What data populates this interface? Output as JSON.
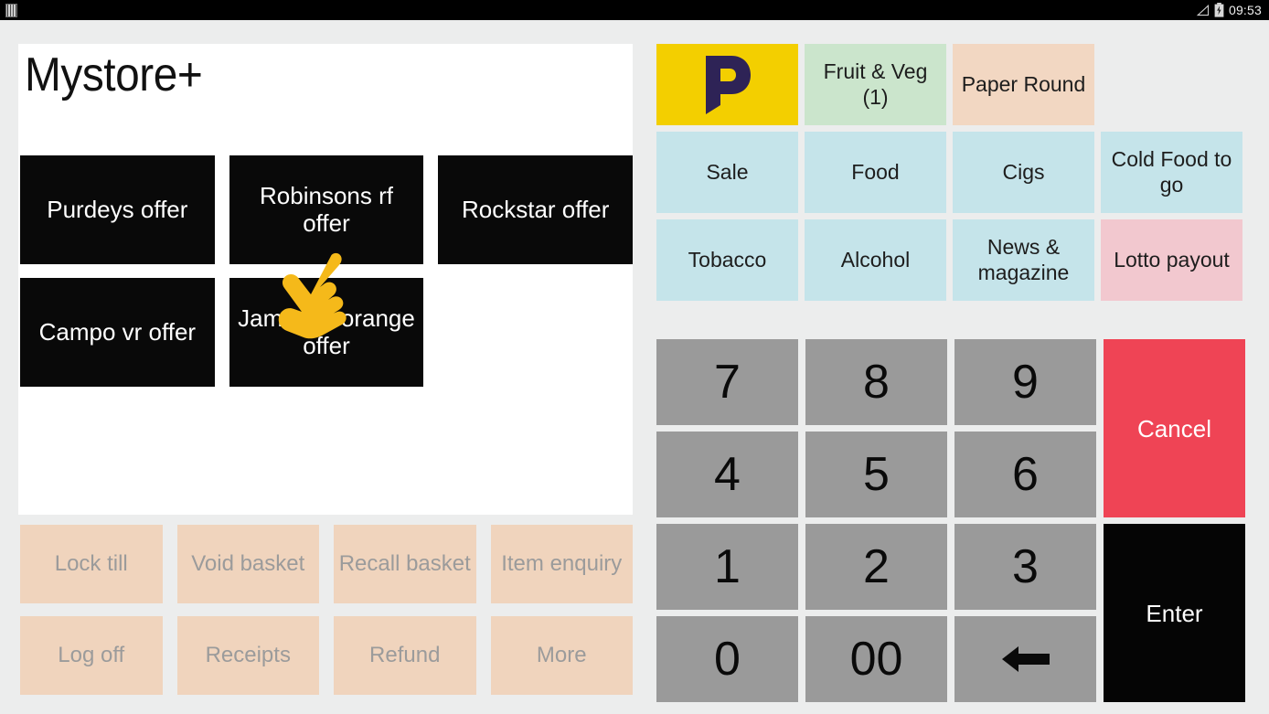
{
  "status_bar": {
    "left_icon": "barcode-icon",
    "signal_icon": "signal-triangle-icon",
    "battery_icon": "battery-charging-icon",
    "clock": "09:53"
  },
  "store": {
    "logo_text": "Mystore+"
  },
  "offers": [
    [
      {
        "label": "Purdeys offer"
      },
      {
        "label": "Robinsons rf offer"
      },
      {
        "label": "Rockstar offer"
      }
    ],
    [
      {
        "label": "Campo vr offer"
      },
      {
        "label": "Jameson orange offer"
      },
      {
        "label": ""
      }
    ]
  ],
  "touch_indicator": {
    "icon": "pointing-hand-icon",
    "color": "#f5b91a"
  },
  "function_buttons": [
    [
      {
        "label": "Lock till"
      },
      {
        "label": "Void basket"
      },
      {
        "label": "Recall basket"
      },
      {
        "label": "Item enquiry"
      }
    ],
    [
      {
        "label": "Log off"
      },
      {
        "label": "Receipts"
      },
      {
        "label": "Refund"
      },
      {
        "label": "More"
      }
    ]
  ],
  "categories": [
    [
      {
        "label": "",
        "icon": "payzone-p-logo",
        "color": "#f3cf00",
        "type": "logo"
      },
      {
        "label": "Fruit & Veg (1)",
        "color": "#cbe5cc",
        "type": "text"
      },
      {
        "label": "Paper Round",
        "color": "#f2d7c2",
        "type": "text"
      },
      {
        "label": "",
        "color": "transparent",
        "type": "blank"
      }
    ],
    [
      {
        "label": "Sale",
        "color": "#c5e4ea",
        "type": "text"
      },
      {
        "label": "Food",
        "color": "#c5e4ea",
        "type": "text"
      },
      {
        "label": "Cigs",
        "color": "#c5e4ea",
        "type": "text"
      },
      {
        "label": "Cold Food to go",
        "color": "#c5e4ea",
        "type": "text"
      }
    ],
    [
      {
        "label": "Tobacco",
        "color": "#c5e4ea",
        "type": "text"
      },
      {
        "label": "Alcohol",
        "color": "#c5e4ea",
        "type": "text"
      },
      {
        "label": "News & magazine",
        "color": "#c5e4ea",
        "type": "text"
      },
      {
        "label": "Lotto payout",
        "color": "#f2c8cf",
        "type": "text"
      }
    ]
  ],
  "keypad": {
    "keys": [
      {
        "label": "7",
        "name": "key-7"
      },
      {
        "label": "8",
        "name": "key-8"
      },
      {
        "label": "9",
        "name": "key-9"
      },
      {
        "label": "4",
        "name": "key-4"
      },
      {
        "label": "5",
        "name": "key-5"
      },
      {
        "label": "6",
        "name": "key-6"
      },
      {
        "label": "1",
        "name": "key-1"
      },
      {
        "label": "2",
        "name": "key-2"
      },
      {
        "label": "3",
        "name": "key-3"
      },
      {
        "label": "0",
        "name": "key-0"
      },
      {
        "label": "00",
        "name": "key-double-zero"
      },
      {
        "label": "",
        "name": "key-backspace",
        "icon": "backspace-arrow-icon"
      }
    ],
    "cancel_label": "Cancel",
    "enter_label": "Enter"
  },
  "colors": {
    "background": "#eceded",
    "panel": "#ffffff",
    "offer_tile": "#090909",
    "function_tile": "#f0d4bd",
    "function_text": "#9b9b9b",
    "keypad_key": "#9a9a9a",
    "cancel": "#ef4455",
    "enter": "#050505",
    "payzone_yellow": "#f3cf00",
    "payzone_navy": "#2e2356"
  }
}
